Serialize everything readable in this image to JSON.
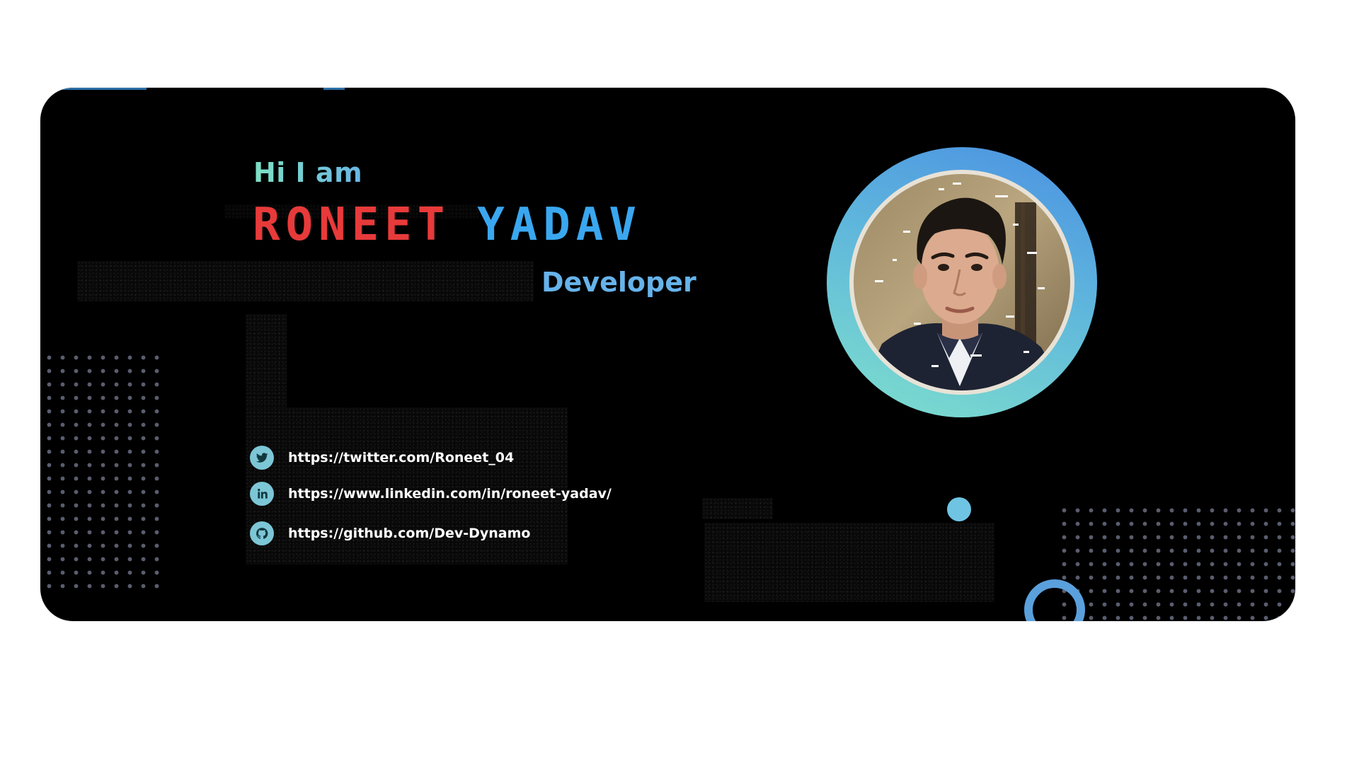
{
  "greeting": "Hi I am",
  "name": {
    "first": "RONEET",
    "last": "YADAV"
  },
  "role": "Developer",
  "portrait": {
    "alt": "profile photo"
  },
  "links": [
    {
      "icon": "twitter-icon",
      "text": "https://twitter.com/Roneet_04"
    },
    {
      "icon": "linkedin-icon",
      "text": "https://www.linkedin.com/in/roneet-yadav/"
    },
    {
      "icon": "github-icon",
      "text": "https://github.com/Dev-Dynamo"
    }
  ],
  "colors": {
    "background": "#000000",
    "first_name": "#e83a3a",
    "last_name": "#3aa7f0",
    "role": "#66b3ea",
    "greeting_gradient": [
      "#7fe0c4",
      "#6ab7e6"
    ],
    "ring_gradient": [
      "#4a90e2",
      "#7fe0cc"
    ],
    "icon_bg": "#7cc6d6",
    "dot_grid": "#5a5d6e"
  }
}
